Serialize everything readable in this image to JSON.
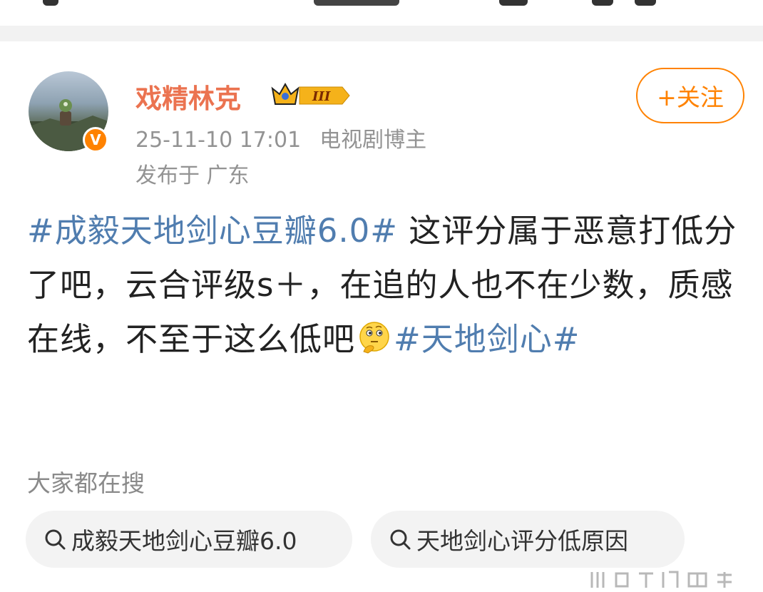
{
  "post": {
    "author": "戏精林克",
    "level_badge": "III",
    "timestamp": "25-11-10 17:01",
    "role": "电视剧博主",
    "location": "发布于 广东",
    "follow_label": "+关注",
    "content": {
      "tag1": "#成毅天地剑心豆瓣6.0#",
      "text1": " 这评分属于恶意打低分了吧，云合评级s＋，在追的人也不在少数，质感在线，不至于这么低吧",
      "emoji": "thinking-face-emoji",
      "tag2": "#天地剑心#"
    }
  },
  "search": {
    "heading": "大家都在搜",
    "items": [
      "成毅天地剑心豆瓣6.0",
      "天地剑心评分低原因"
    ]
  },
  "colors": {
    "username": "#eb7350",
    "tag": "#507daf",
    "follow": "#ff8200",
    "meta": "#939393"
  }
}
